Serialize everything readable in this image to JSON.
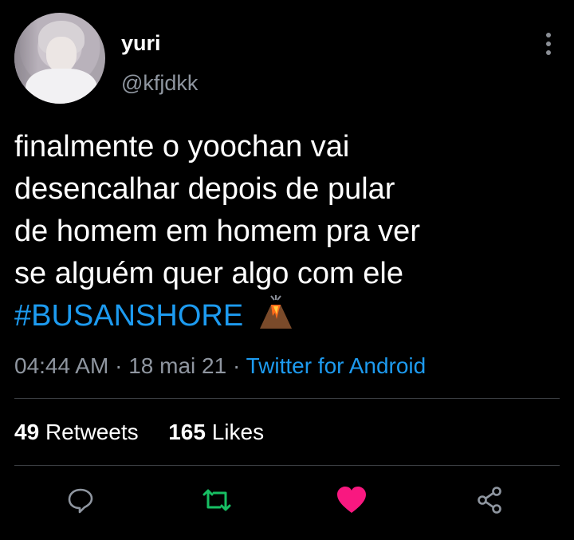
{
  "user": {
    "name": "yuri",
    "handle": "@kfjdkk"
  },
  "tweet": {
    "lines": [
      "finalmente o yoochan vai",
      "desencalhar depois de pular",
      "de homem em homem pra ver",
      "se alguém quer algo com ele"
    ],
    "hashtag": "#BUSANSHORE",
    "emoji": "volcano-emoji"
  },
  "meta": {
    "time": "04:44 AM",
    "separator": "·",
    "date": "18 mai 21",
    "source": "Twitter for Android"
  },
  "stats": {
    "retweets_count": "49",
    "retweets_label": "Retweets",
    "likes_count": "165",
    "likes_label": "Likes"
  },
  "colors": {
    "background": "#000000",
    "link": "#1d9bf0",
    "muted": "#8f96a0",
    "retweet": "#17bf63",
    "like": "#f91880"
  },
  "icons": [
    "more-options-icon",
    "reply-icon",
    "retweet-icon",
    "like-icon",
    "share-icon"
  ]
}
